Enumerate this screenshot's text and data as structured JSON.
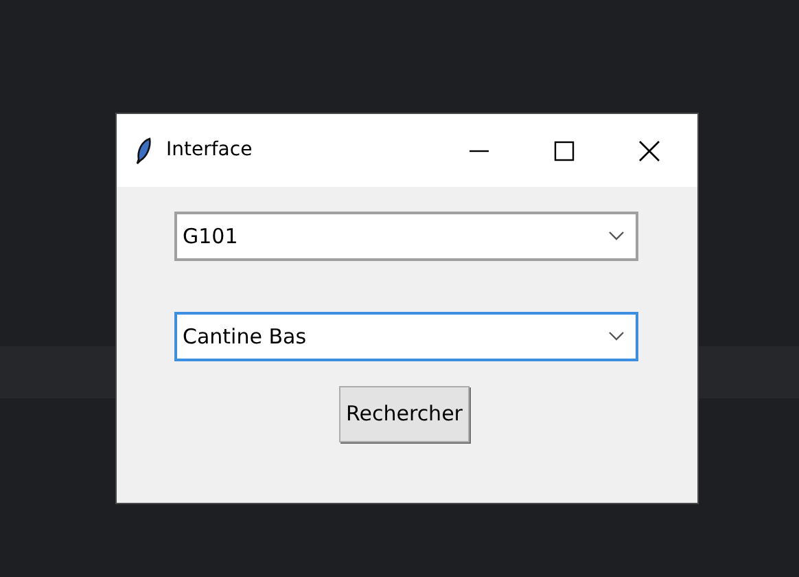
{
  "window": {
    "title": "Interface"
  },
  "fields": [
    {
      "value": "G101",
      "focused": false
    },
    {
      "value": "Cantine Bas",
      "focused": true
    }
  ],
  "buttons": [
    "Rechercher"
  ]
}
